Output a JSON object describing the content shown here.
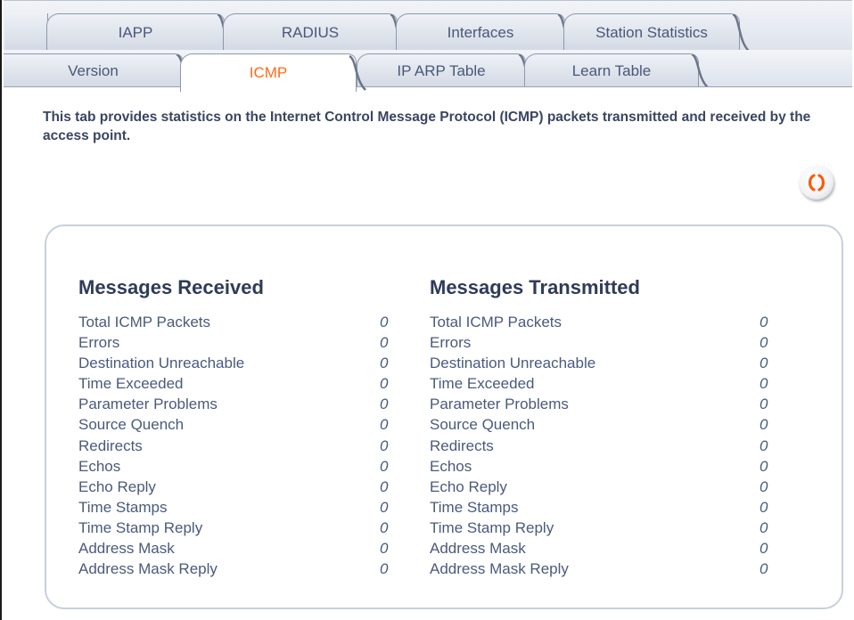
{
  "tabs": {
    "row1": [
      "IAPP",
      "RADIUS",
      "Interfaces",
      "Station Statistics"
    ],
    "row2": [
      "Version",
      "ICMP",
      "IP ARP Table",
      "Learn Table"
    ],
    "active": "ICMP"
  },
  "description": "This tab provides statistics on the Internet Control Message Protocol (ICMP) packets transmitted and received by the access point.",
  "refresh_icon": "refresh-icon",
  "colors": {
    "active_tab_text": "#ff6a1a",
    "heading": "#2f3b58",
    "text": "#4a5a7c",
    "panel_border": "#c8cfdc"
  },
  "received": {
    "title": "Messages Received",
    "rows": [
      {
        "label": "Total ICMP Packets",
        "value": "0"
      },
      {
        "label": "Errors",
        "value": "0"
      },
      {
        "label": "Destination Unreachable",
        "value": "0"
      },
      {
        "label": "Time Exceeded",
        "value": "0"
      },
      {
        "label": "Parameter Problems",
        "value": "0"
      },
      {
        "label": "Source Quench",
        "value": "0"
      },
      {
        "label": "Redirects",
        "value": "0"
      },
      {
        "label": "Echos",
        "value": "0"
      },
      {
        "label": "Echo Reply",
        "value": "0"
      },
      {
        "label": "Time Stamps",
        "value": "0"
      },
      {
        "label": "Time Stamp Reply",
        "value": "0"
      },
      {
        "label": "Address Mask",
        "value": "0"
      },
      {
        "label": "Address Mask Reply",
        "value": "0"
      }
    ]
  },
  "transmitted": {
    "title": "Messages Transmitted",
    "rows": [
      {
        "label": "Total ICMP Packets",
        "value": "0"
      },
      {
        "label": "Errors",
        "value": "0"
      },
      {
        "label": "Destination Unreachable",
        "value": "0"
      },
      {
        "label": "Time Exceeded",
        "value": "0"
      },
      {
        "label": "Parameter Problems",
        "value": "0"
      },
      {
        "label": "Source Quench",
        "value": "0"
      },
      {
        "label": "Redirects",
        "value": "0"
      },
      {
        "label": "Echos",
        "value": "0"
      },
      {
        "label": "Echo Reply",
        "value": "0"
      },
      {
        "label": "Time Stamps",
        "value": "0"
      },
      {
        "label": "Time Stamp Reply",
        "value": "0"
      },
      {
        "label": "Address Mask",
        "value": "0"
      },
      {
        "label": "Address Mask Reply",
        "value": "0"
      }
    ]
  }
}
